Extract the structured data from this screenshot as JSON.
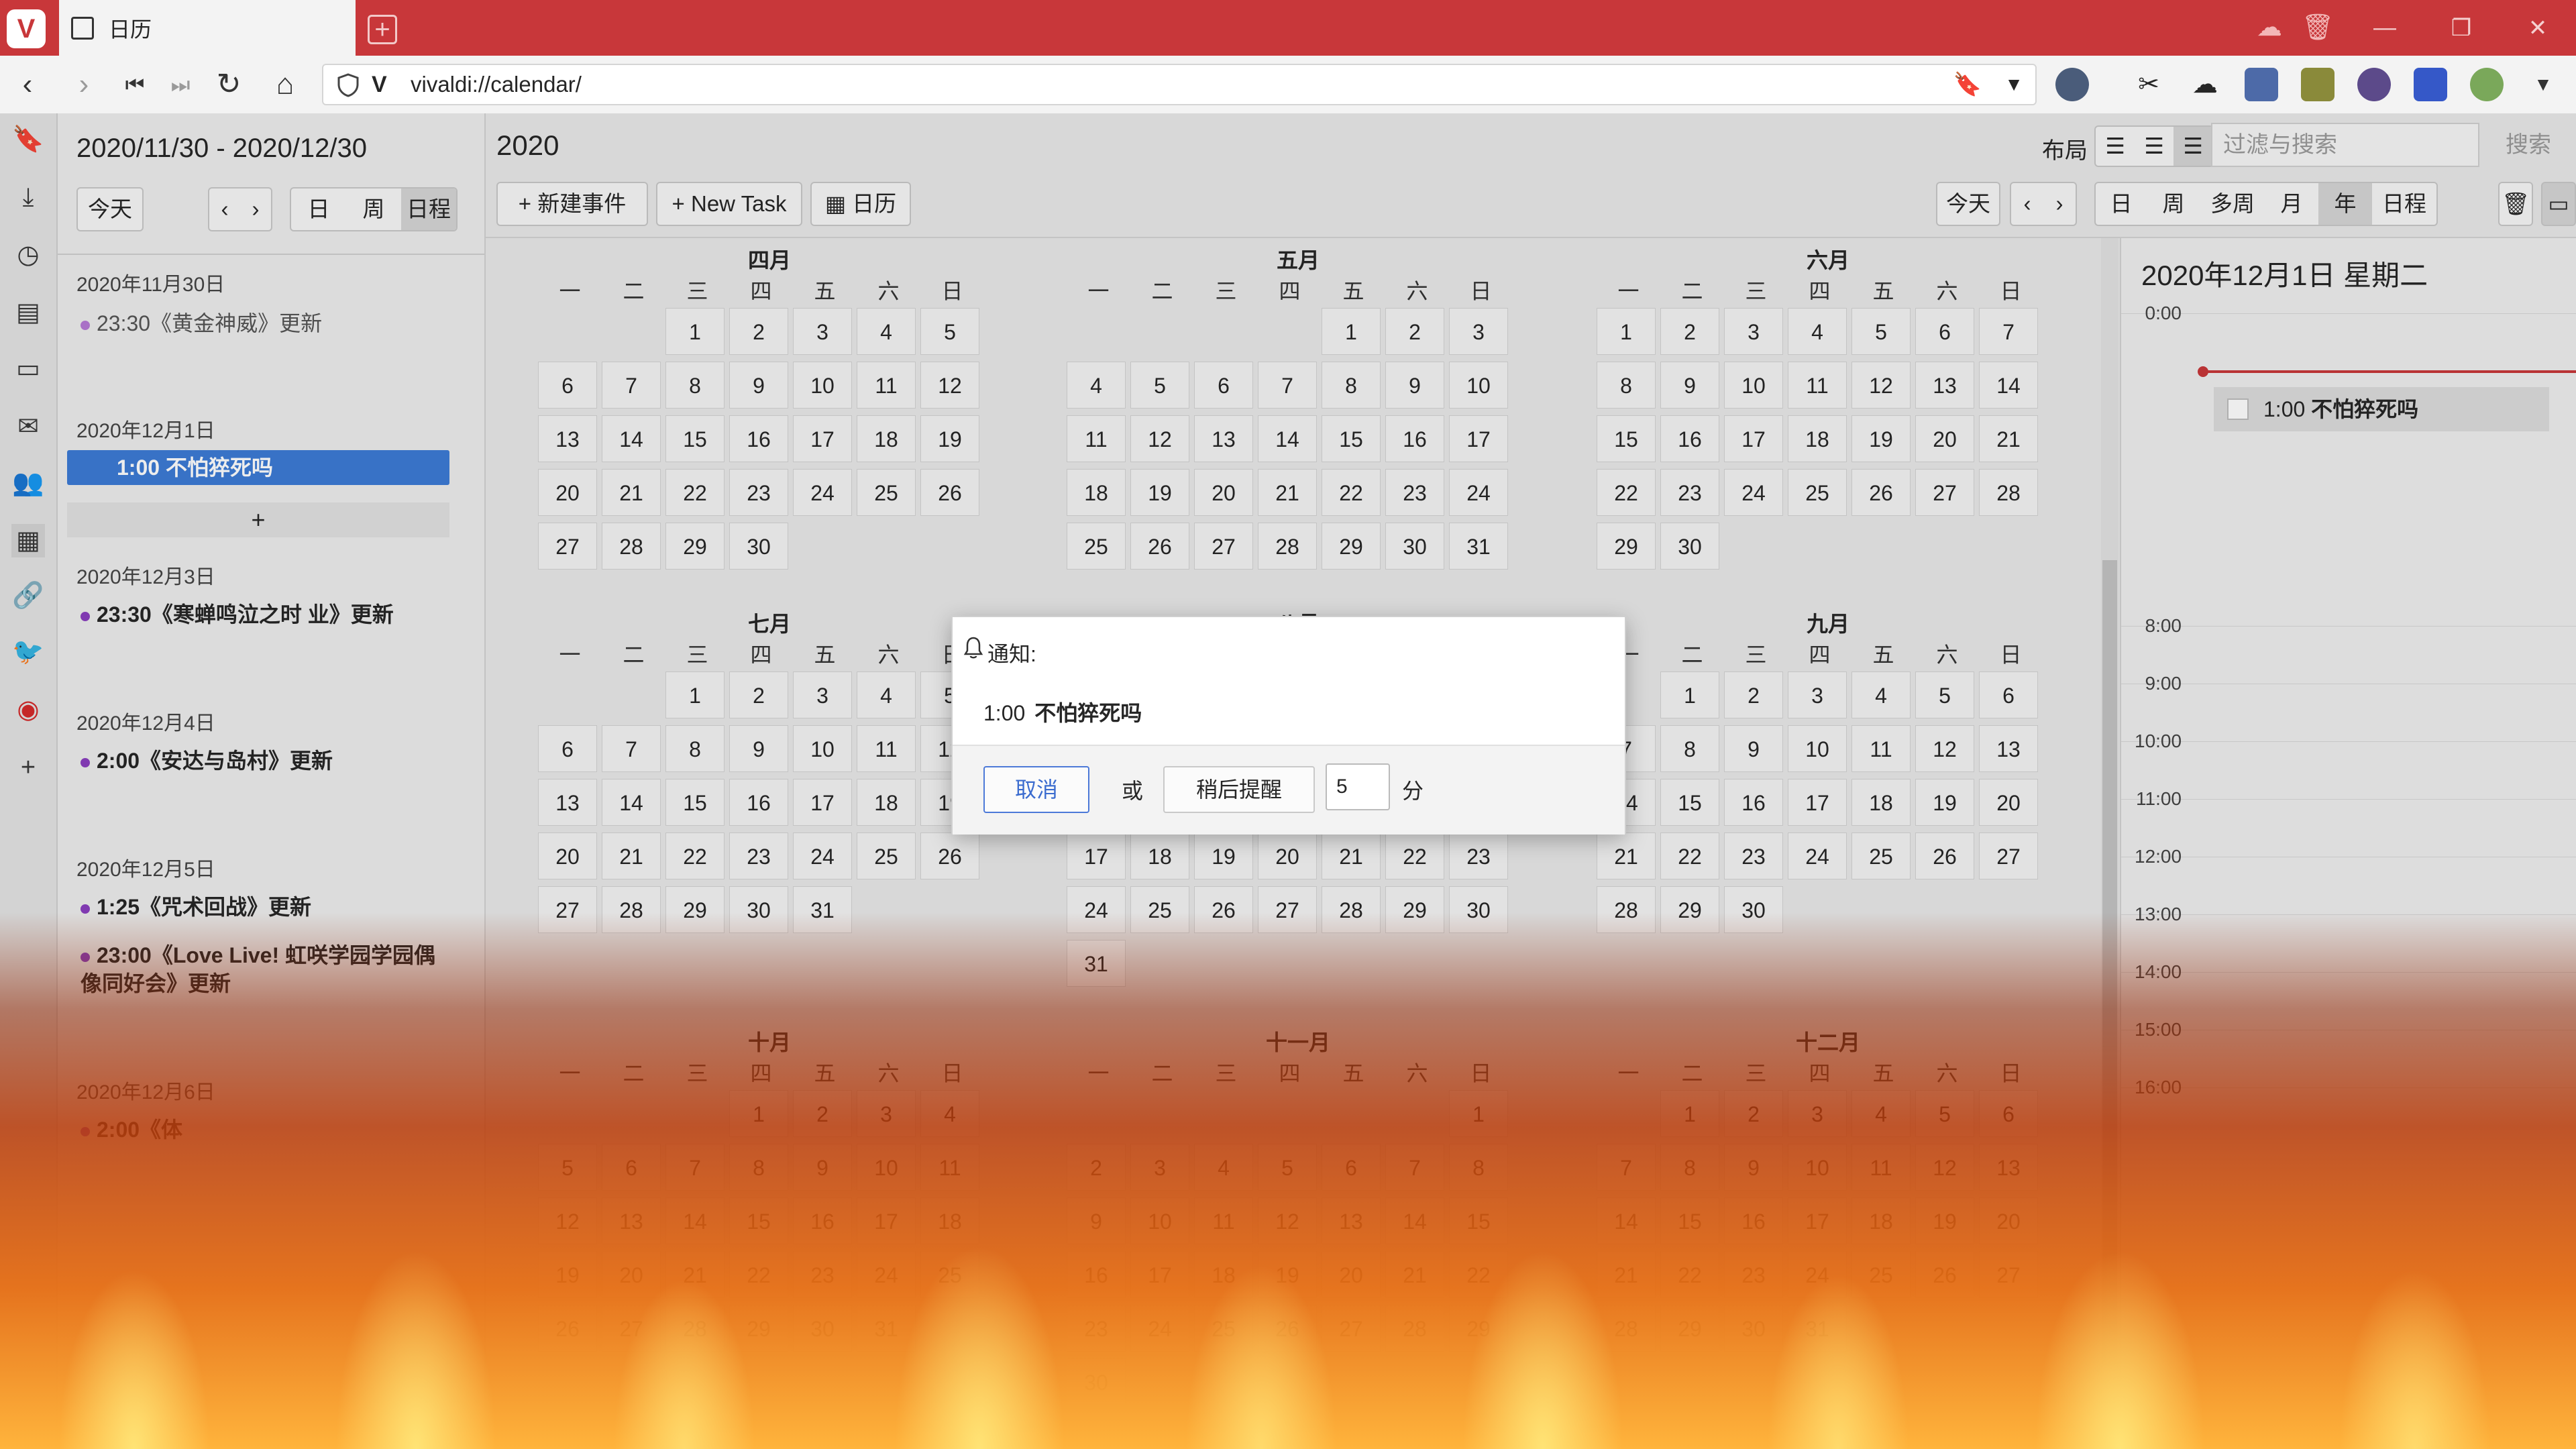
{
  "browser": {
    "tab_title": "日历",
    "url": "vivaldi://calendar/",
    "logo_letter": "V"
  },
  "agenda": {
    "range": "2020/11/30 - 2020/12/30",
    "today_btn": "今天",
    "view_day": "日",
    "view_week": "周",
    "view_schedule": "日程",
    "plus": "+",
    "days": [
      {
        "date": "2020年11月30日",
        "events": [
          "23:30《黄金神威》更新"
        ]
      },
      {
        "date": "2020年12月1日",
        "events": [
          "1:00 不怕猝死吗"
        ]
      },
      {
        "date": "2020年12月3日",
        "events": [
          "23:30《寒蝉鸣泣之时 业》更新"
        ]
      },
      {
        "date": "2020年12月4日",
        "events": [
          "2:00《安达与岛村》更新"
        ]
      },
      {
        "date": "2020年12月5日",
        "events": [
          "1:25《咒术回战》更新",
          "23:00《Love Live! 虹咲学园学园偶像同好会》更新"
        ]
      },
      {
        "date": "2020年12月6日",
        "events": [
          "2:00《体"
        ]
      }
    ]
  },
  "toolbar": {
    "year": "2020",
    "new_event": "新建事件",
    "new_task": "New Task",
    "calendar": "日历",
    "layout_label": "布局",
    "filter_placeholder": "过滤与搜索",
    "search": "搜索",
    "today": "今天",
    "views": [
      "日",
      "周",
      "多周",
      "月",
      "年",
      "日程"
    ],
    "active_view": "年"
  },
  "weekdays": [
    "一",
    "二",
    "三",
    "四",
    "五",
    "六",
    "日"
  ],
  "months": [
    {
      "name": "四月",
      "offset": 2,
      "days": 30
    },
    {
      "name": "五月",
      "offset": 4,
      "days": 31
    },
    {
      "name": "六月",
      "offset": 0,
      "days": 30
    },
    {
      "name": "七月",
      "offset": 2,
      "days": 31
    },
    {
      "name": "八月",
      "offset": 5,
      "days": 31
    },
    {
      "name": "九月",
      "offset": 1,
      "days": 30
    },
    {
      "name": "十月",
      "offset": 3,
      "days": 31
    },
    {
      "name": "十一月",
      "offset": 6,
      "days": 30
    },
    {
      "name": "十二月",
      "offset": 1,
      "days": 31
    }
  ],
  "day_panel": {
    "title": "2020年12月1日 星期二",
    "hours": [
      "0:00",
      "8:00",
      "9:00",
      "10:00",
      "11:00",
      "12:00",
      "13:00",
      "14:00",
      "15:00",
      "16:00"
    ],
    "event_time": "1:00",
    "event_title": "不怕猝死吗"
  },
  "dialog": {
    "header": "通知:",
    "time": "1:00",
    "title": "不怕猝死吗",
    "cancel": "取消",
    "or": "或",
    "snooze": "稍后提醒",
    "minutes": "5",
    "unit": "分"
  },
  "colors": {
    "accent": "#c8373a",
    "event_dot": "#8a3fbf",
    "selected_event": "#3d7bd5"
  }
}
